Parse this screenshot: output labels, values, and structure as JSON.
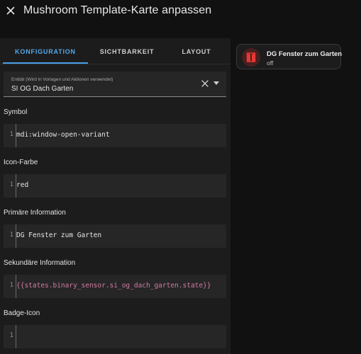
{
  "header": {
    "title": "Mushroom Template-Karte anpassen",
    "close_icon": "close-icon"
  },
  "tabs": [
    {
      "label": "KONFIGURATION",
      "active": true
    },
    {
      "label": "SICHTBARKEIT",
      "active": false
    },
    {
      "label": "LAYOUT",
      "active": false
    }
  ],
  "entity": {
    "label": "Entität (Wird in Vorlagen und Aktionen verwendet)",
    "value": "SI OG Dach Garten",
    "clear_icon": "clear-icon",
    "dropdown_icon": "caret-down-icon"
  },
  "fields": {
    "symbol": {
      "label": "Symbol",
      "line": "1",
      "value": "mdi:window-open-variant"
    },
    "icon_color": {
      "label": "Icon-Farbe",
      "line": "1",
      "value": "red"
    },
    "primary": {
      "label": "Primäre Information",
      "line": "1",
      "value": "DG Fenster zum Garten"
    },
    "secondary": {
      "label": "Sekundäre Information",
      "line": "1",
      "value": "{{states.binary_sensor.si_og_dach_garten.state}}"
    },
    "badge_icon": {
      "label": "Badge-Icon",
      "line": "1",
      "value": ""
    }
  },
  "preview": {
    "primary": "DG Fenster zum Garten",
    "secondary": "off",
    "icon": "window-open-variant-icon",
    "icon_color": "#e53935"
  },
  "colors": {
    "accent": "#4a9fe8",
    "icon_red": "#e53935",
    "template_text": "#d17ba3"
  }
}
